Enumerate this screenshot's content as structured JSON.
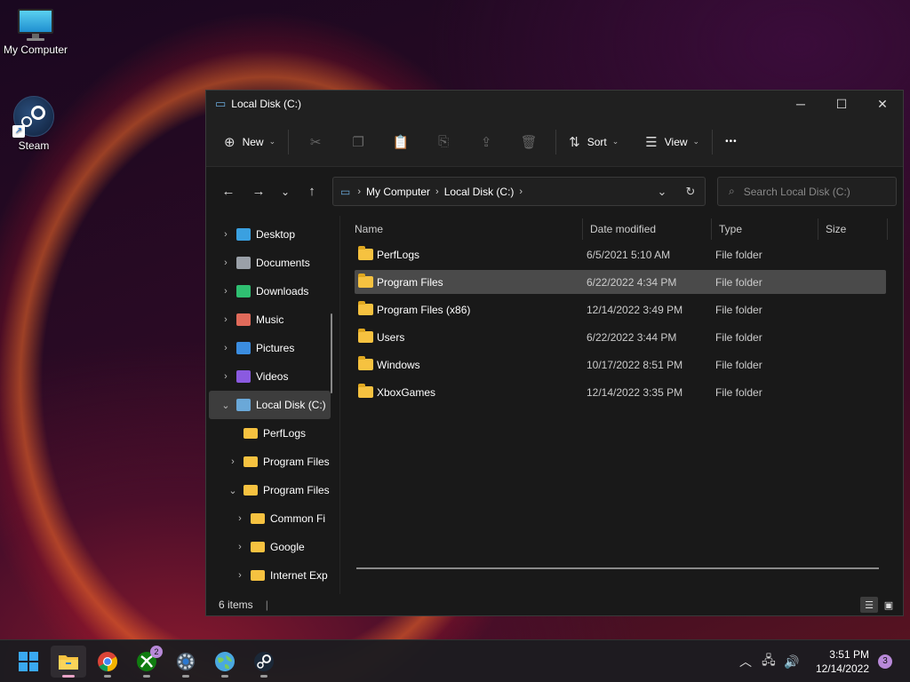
{
  "desktop": {
    "icons": [
      {
        "label": "My Computer",
        "icon": "monitor-icon"
      },
      {
        "label": "Steam",
        "icon": "steam-icon"
      }
    ]
  },
  "window": {
    "title": "Local Disk (C:)",
    "controls": {
      "minimize": "─",
      "maximize": "☐",
      "close": "✕"
    },
    "toolbar": {
      "new_label": "New",
      "sort_label": "Sort",
      "view_label": "View",
      "more_label": "•••"
    },
    "address": {
      "crumbs": [
        "My Computer",
        "Local Disk (C:)"
      ]
    },
    "search": {
      "placeholder": "Search Local Disk (C:)"
    },
    "columns": {
      "name": "Name",
      "date": "Date modified",
      "type": "Type",
      "size": "Size"
    },
    "nav": [
      {
        "label": "Desktop",
        "expander": "›",
        "icon": "desktop-icon",
        "color": "#3aa0e0"
      },
      {
        "label": "Documents",
        "expander": "›",
        "icon": "documents-icon",
        "color": "#9aa0a8"
      },
      {
        "label": "Downloads",
        "expander": "›",
        "icon": "downloads-icon",
        "color": "#2fbf71"
      },
      {
        "label": "Music",
        "expander": "›",
        "icon": "music-icon",
        "color": "#e06a5a"
      },
      {
        "label": "Pictures",
        "expander": "›",
        "icon": "pictures-icon",
        "color": "#3b8de0"
      },
      {
        "label": "Videos",
        "expander": "›",
        "icon": "videos-icon",
        "color": "#8a5ae0"
      },
      {
        "label": "Local Disk (C:)",
        "expander": "⌄",
        "icon": "drive-icon",
        "color": "#6aa8d8"
      },
      {
        "label": "PerfLogs",
        "expander": "",
        "icon": "folder-icon",
        "color": "#f6c240"
      },
      {
        "label": "Program Files",
        "expander": "›",
        "icon": "folder-icon",
        "color": "#f6c240"
      },
      {
        "label": "Program Files",
        "expander": "⌄",
        "icon": "folder-icon",
        "color": "#f6c240"
      },
      {
        "label": "Common Fi",
        "expander": "›",
        "icon": "folder-icon",
        "color": "#f6c240"
      },
      {
        "label": "Google",
        "expander": "›",
        "icon": "folder-icon",
        "color": "#f6c240"
      },
      {
        "label": "Internet Exp",
        "expander": "›",
        "icon": "folder-icon",
        "color": "#f6c240"
      }
    ],
    "files": [
      {
        "name": "PerfLogs",
        "date": "6/5/2021 5:10 AM",
        "type": "File folder"
      },
      {
        "name": "Program Files",
        "date": "6/22/2022 4:34 PM",
        "type": "File folder"
      },
      {
        "name": "Program Files (x86)",
        "date": "12/14/2022 3:49 PM",
        "type": "File folder"
      },
      {
        "name": "Users",
        "date": "6/22/2022 3:44 PM",
        "type": "File folder"
      },
      {
        "name": "Windows",
        "date": "10/17/2022 8:51 PM",
        "type": "File folder"
      },
      {
        "name": "XboxGames",
        "date": "12/14/2022 3:35 PM",
        "type": "File folder"
      }
    ],
    "status": {
      "items": "6 items"
    }
  },
  "taskbar": {
    "apps": [
      {
        "name": "start-button",
        "icon": "windows-icon"
      },
      {
        "name": "file-explorer",
        "icon": "folder-icon",
        "active": true
      },
      {
        "name": "chrome",
        "icon": "chrome-icon"
      },
      {
        "name": "xbox",
        "icon": "xbox-icon",
        "badge": "2"
      },
      {
        "name": "settings",
        "icon": "gear-icon"
      },
      {
        "name": "globe-app",
        "icon": "globe-icon"
      },
      {
        "name": "steam",
        "icon": "steam-icon"
      }
    ],
    "clock": {
      "time": "3:51 PM",
      "date": "12/14/2022"
    },
    "notifications": "3"
  }
}
